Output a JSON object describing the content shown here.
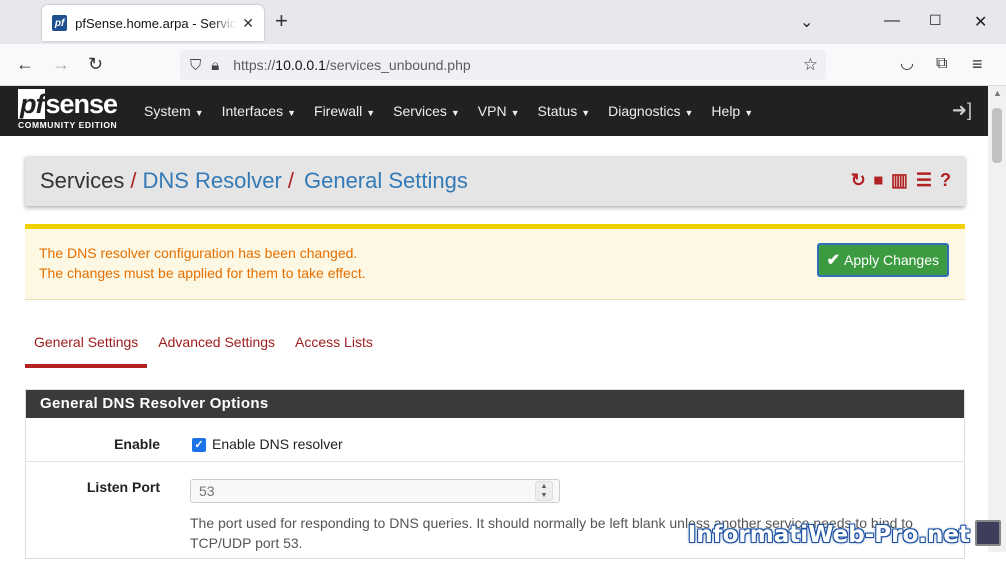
{
  "browser": {
    "tab_title": "pfSense.home.arpa - Services: DNS Resolver: General Settings",
    "favicon_text": "pf",
    "url_prefix": "https://",
    "url_host": "10.0.0.1",
    "url_path": "/services_unbound.php"
  },
  "header": {
    "brand_pf": "pf",
    "brand_sense": "sense",
    "edition": "COMMUNITY EDITION",
    "menu": [
      "System",
      "Interfaces",
      "Firewall",
      "Services",
      "VPN",
      "Status",
      "Diagnostics",
      "Help"
    ]
  },
  "breadcrumb": {
    "part1": "Services",
    "part2": "DNS Resolver",
    "part3": "General Settings"
  },
  "alert": {
    "line1": "The DNS resolver configuration has been changed.",
    "line2": "The changes must be applied for them to take effect.",
    "apply_label": "Apply Changes"
  },
  "tabs": [
    "General Settings",
    "Advanced Settings",
    "Access Lists"
  ],
  "panel": {
    "title": "General DNS Resolver Options",
    "enable_label": "Enable",
    "enable_checkbox_label": "Enable DNS resolver",
    "enable_checked": true,
    "listen_port_label": "Listen Port",
    "listen_port_placeholder": "53",
    "listen_port_help_1": "The port used for responding to DNS queries. It should normally be left blank unless another service needs to bind to",
    "listen_port_help_2": "TCP/UDP port 53."
  },
  "watermark": "InformatiWeb-Pro.net",
  "colors": {
    "header_bg": "#212121",
    "link_blue": "#337ab7",
    "accent_red": "#b22222",
    "alert_text": "#e56f00",
    "alert_bg": "#fcf8e3",
    "apply_green": "#3c9b41"
  }
}
